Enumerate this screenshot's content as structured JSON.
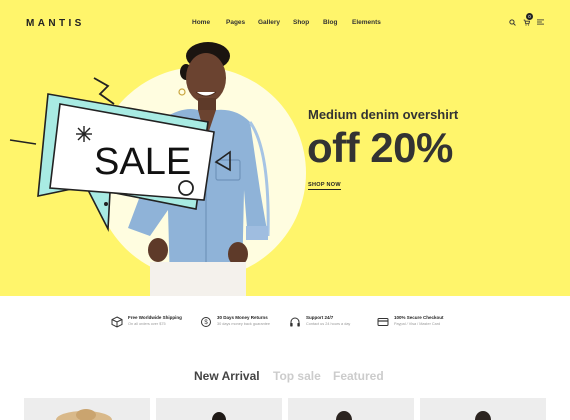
{
  "brand": {
    "logo": "MANTIS"
  },
  "nav": {
    "items": [
      "Home",
      "Pages",
      "Gallery",
      "Shop",
      "Blog",
      "Elements"
    ]
  },
  "header": {
    "cart_count": "0",
    "icons": [
      "search-icon",
      "cart-icon",
      "menu-icon"
    ]
  },
  "hero": {
    "badge_text": "SALE",
    "subtitle": "Medium denim overshirt",
    "title": "off 20%",
    "cta": "SHOP NOW",
    "colors": {
      "background": "#fff56b",
      "disc": "#fffde0",
      "badge_teal": "#a8ebe3",
      "text": "#333333"
    }
  },
  "features": [
    {
      "icon": "box-icon",
      "title": "Free Worldwide Shipping",
      "subtitle": "On all orders over $75"
    },
    {
      "icon": "money-back-icon",
      "title": "30 Days Money Returns",
      "subtitle": "30 days money back guarantee"
    },
    {
      "icon": "headphones-icon",
      "title": "Support 24/7",
      "subtitle": "Contact us 24 hours a day"
    },
    {
      "icon": "card-icon",
      "title": "100% Secure Checkout",
      "subtitle": "Paypal / Visa / Master Card"
    }
  ],
  "tabs": [
    {
      "label": "New Arrival",
      "active": true
    },
    {
      "label": "Top sale",
      "active": false
    },
    {
      "label": "Featured",
      "active": false
    }
  ]
}
